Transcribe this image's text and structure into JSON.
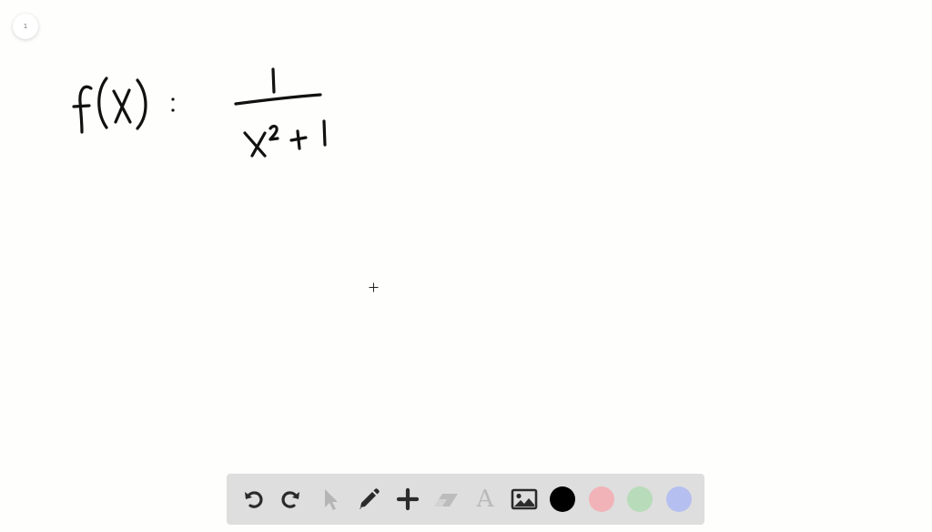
{
  "page": {
    "number": "1"
  },
  "canvas": {
    "ink_color": "#111111",
    "handwriting": {
      "lhs": "f(x) :",
      "numerator": "1",
      "denominator": "x² + 1"
    }
  },
  "toolbar": {
    "tools": [
      {
        "name": "undo",
        "icon": "undo-icon",
        "enabled": true
      },
      {
        "name": "redo",
        "icon": "redo-icon",
        "enabled": true
      },
      {
        "name": "select",
        "icon": "cursor-arrow-icon",
        "enabled": false
      },
      {
        "name": "pen",
        "icon": "pencil-icon",
        "enabled": true
      },
      {
        "name": "add",
        "icon": "plus-icon",
        "enabled": true
      },
      {
        "name": "eraser",
        "icon": "eraser-icon",
        "enabled": false
      },
      {
        "name": "text",
        "icon": "text-icon",
        "glyph": "A",
        "enabled": false
      },
      {
        "name": "image",
        "icon": "image-icon",
        "enabled": true
      }
    ],
    "colors": [
      {
        "name": "black",
        "hex": "#000000",
        "selected": true
      },
      {
        "name": "red",
        "hex": "#f2b3b8",
        "selected": false
      },
      {
        "name": "green",
        "hex": "#b8dbb9",
        "selected": false
      },
      {
        "name": "blue",
        "hex": "#b5bff0",
        "selected": false
      }
    ]
  }
}
